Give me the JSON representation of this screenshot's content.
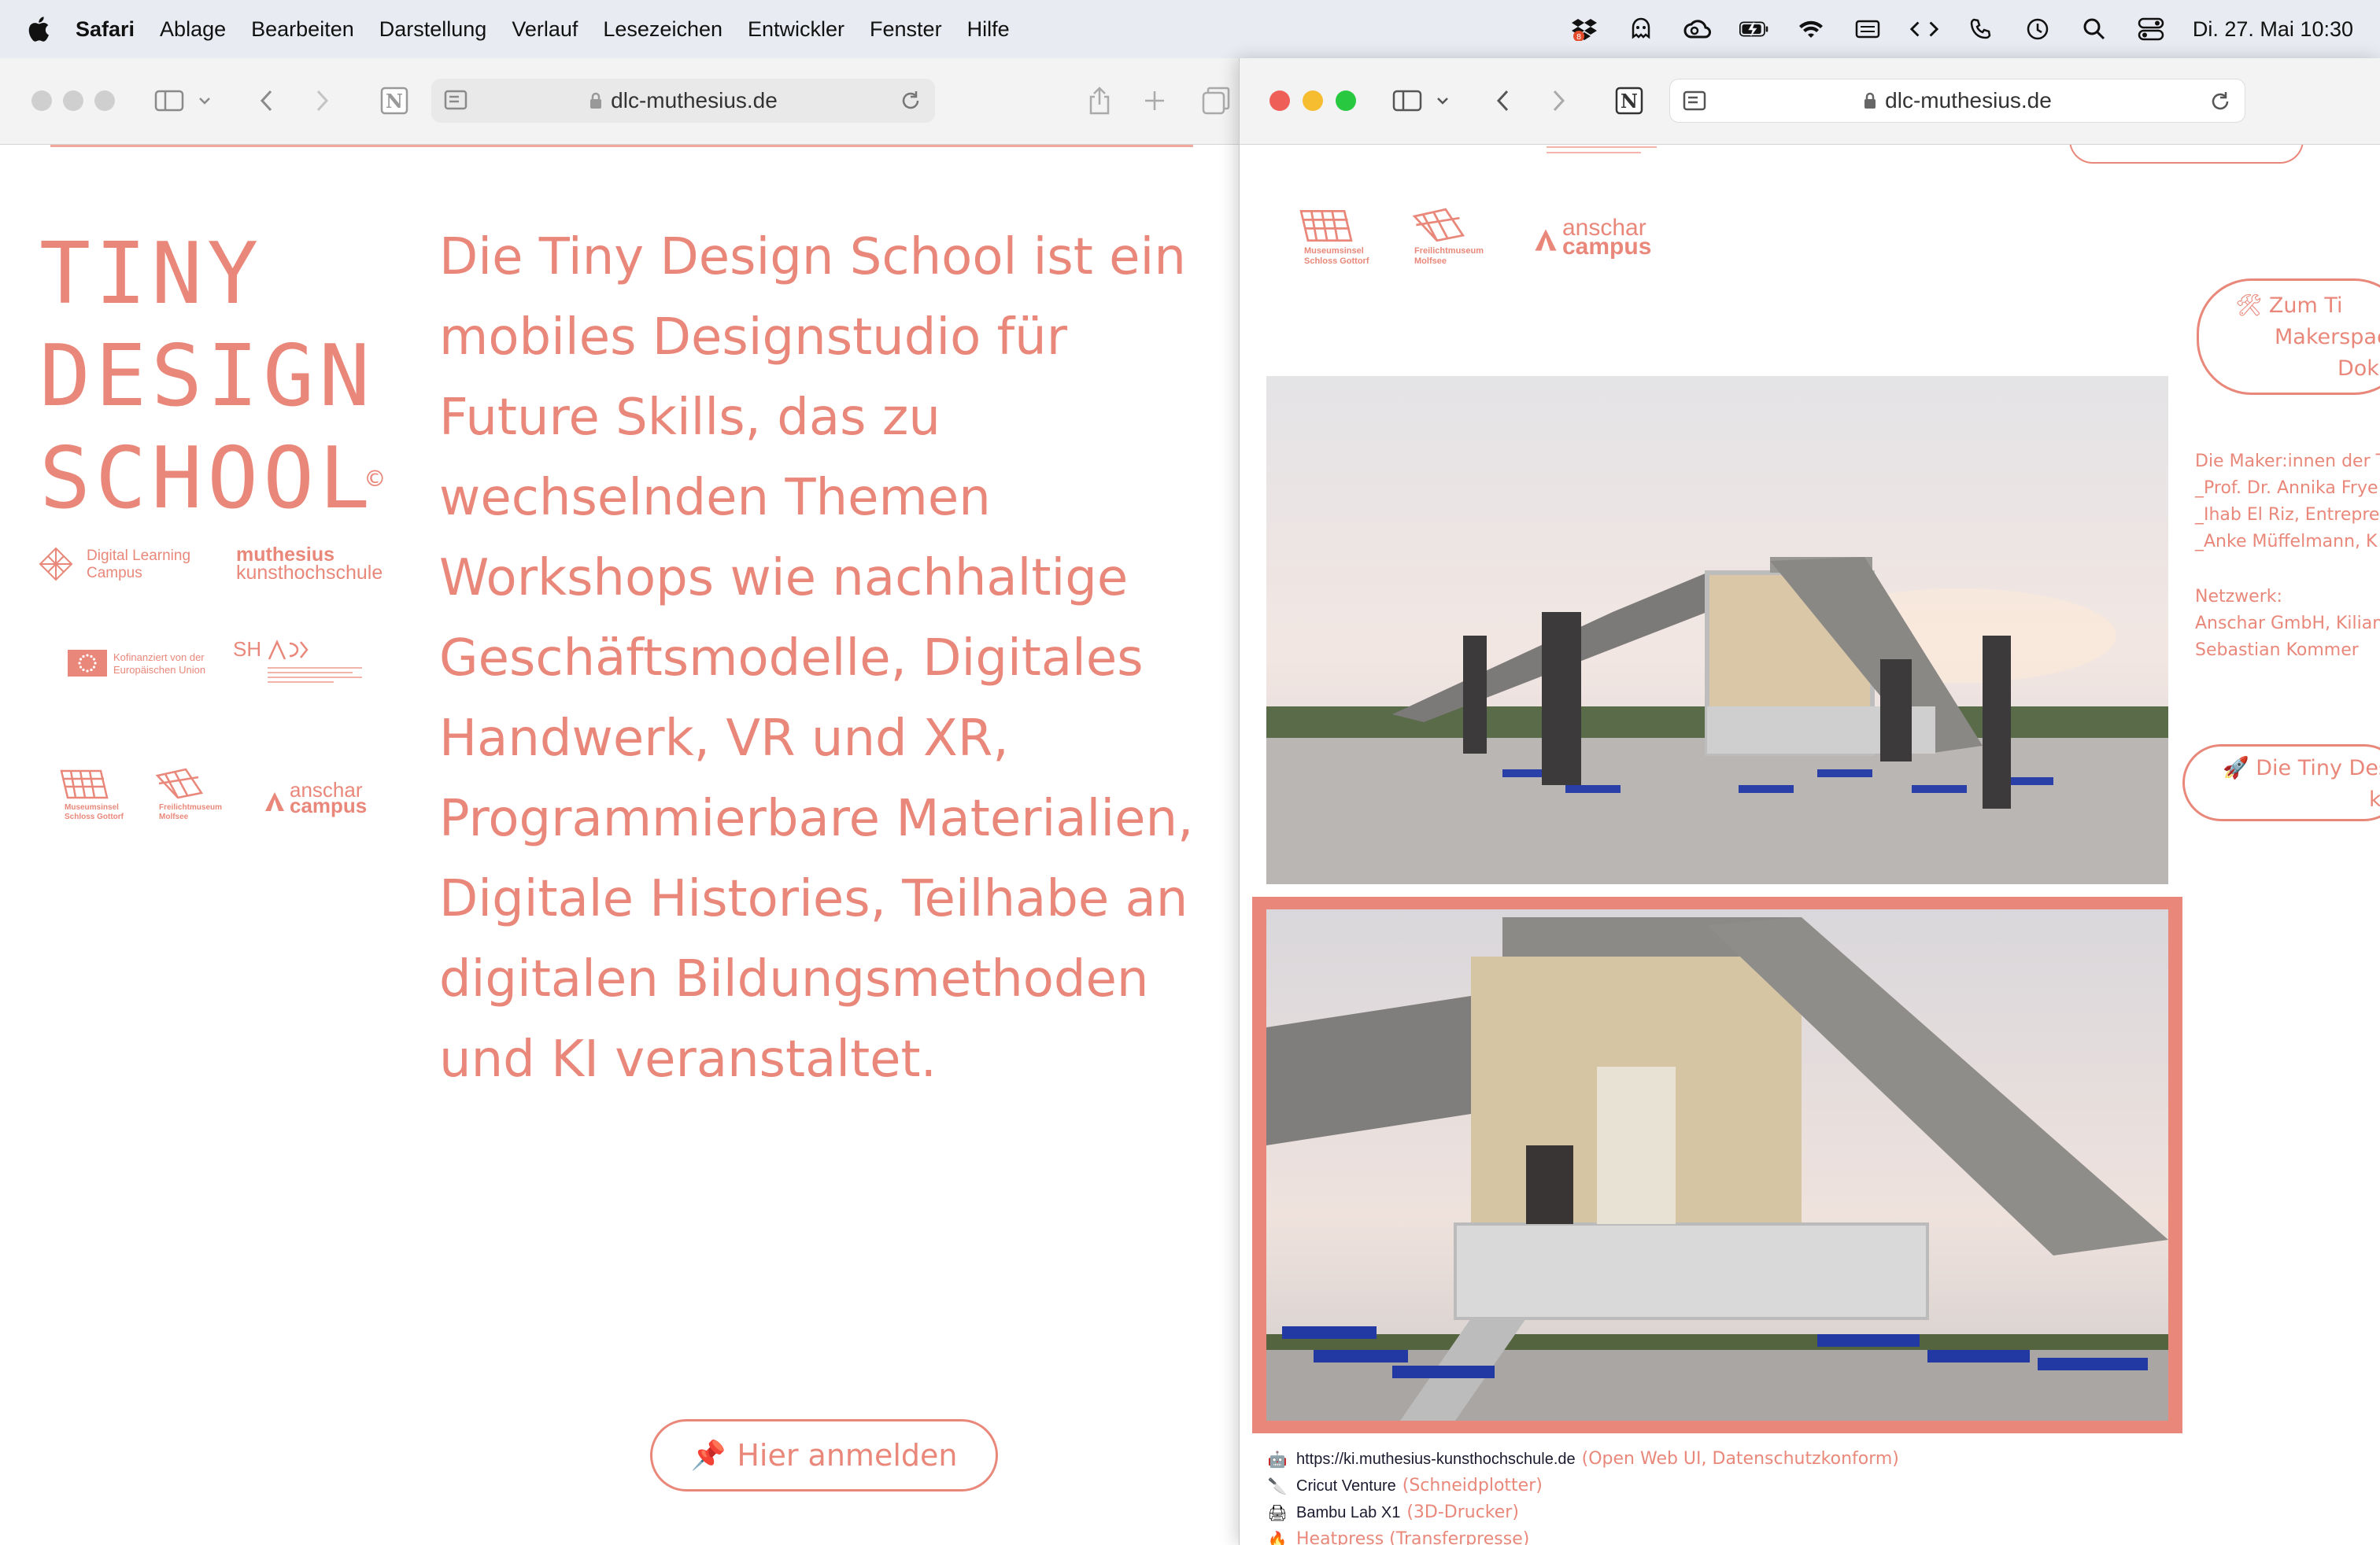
{
  "menubar": {
    "app": "Safari",
    "items": [
      "Ablage",
      "Bearbeiten",
      "Darstellung",
      "Verlauf",
      "Lesezeichen",
      "Entwickler",
      "Fenster",
      "Hilfe"
    ],
    "clock": "Di. 27. Mai  10:30",
    "status_icons": [
      "dropbox-icon",
      "agent-icon",
      "creative-cloud-icon",
      "battery-icon",
      "wifi-icon",
      "keyboard-icon",
      "code-icon",
      "phone-icon",
      "time-machine-icon",
      "search-icon",
      "control-center-icon"
    ]
  },
  "left_window": {
    "url": "dlc-muthesius.de",
    "handwritten_logo_lines": [
      "TINY",
      "DESIGN",
      "SCHOOL"
    ],
    "copyright": "©",
    "logos": {
      "dlc_line1": "Digital Learning",
      "dlc_line2": "Campus",
      "muthesius_line1": "muthesius",
      "muthesius_line2": "kunsthochschule",
      "eu_line1": "Kofinanziert von der",
      "eu_line2": "Europäischen Union",
      "sh_mark": "SH",
      "museum1_line1": "Museumsinsel",
      "museum1_line2": "Schloss Gottorf",
      "museum2_line1": "Freilichtmuseum",
      "museum2_line2": "Molfsee",
      "anschar_line1": "anschar",
      "anschar_line2": "campus"
    },
    "intro_text": "Die Tiny Design School ist ein mobiles Designstudio für Future Skills, das zu wechselnden Themen Workshops wie nachhaltige Geschäftsmodelle, Digitales Handwerk, VR und XR, Programmierbare Materialien, Digitale Histories, Teilhabe an digitalen Bildungsmethoden und KI veranstaltet.",
    "cta_icon": "📌",
    "cta_label": "Hier anmelden"
  },
  "right_window": {
    "url": "dlc-muthesius.de",
    "logos": {
      "museum1_line1": "Museumsinsel",
      "museum1_line2": "Schloss Gottorf",
      "museum2_line1": "Freilichtmuseum",
      "museum2_line2": "Molfsee",
      "anschar_line1": "anschar",
      "anschar_line2": "campus"
    },
    "side_button_1": {
      "icon": "🛠",
      "line1": "Zum Ti",
      "line2": "Makerspac",
      "line3": "Doku"
    },
    "makers_heading": "Die Maker:innen der T",
    "makers": [
      "_Prof. Dr. Annika Frye",
      "_Ihab El Riz, Entrepre",
      "_Anke Müffelmann, K"
    ],
    "network_heading": "Netzwerk:",
    "network": [
      "Anschar GmbH, Kilian",
      "Sebastian Kommer"
    ],
    "side_button_2": {
      "icon": "🚀",
      "line1": "Die Tiny Des",
      "line2": "ko"
    },
    "tools": [
      {
        "icon": "🤖",
        "name": "https://ki.muthesius-kunsthochschule.de",
        "desc": "(Open Web UI, Datenschutzkonform)"
      },
      {
        "icon": "🔪",
        "name": "Cricut Venture",
        "desc": "(Schneidplotter)"
      },
      {
        "icon": "🖨",
        "name": "Bambu Lab X1",
        "desc": "(3D-Drucker)"
      },
      {
        "icon": "🔥",
        "name": "",
        "desc": "Heatpress (Transferpresse)"
      }
    ]
  }
}
